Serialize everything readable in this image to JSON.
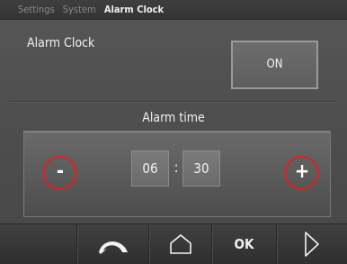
{
  "breadcrumb": {
    "items": [
      "Settings",
      "System",
      "Alarm Clock"
    ]
  },
  "alarm_clock": {
    "label": "Alarm Clock",
    "toggle_label": "ON"
  },
  "alarm_time": {
    "title": "Alarm time",
    "decrement_label": "-",
    "increment_label": "+",
    "hour": "06",
    "separator": ":",
    "minute": "30"
  },
  "nav": {
    "back_icon": "back-arrow-icon",
    "home_icon": "home-icon",
    "ok_label": "OK",
    "next_icon": "next-arrow-icon"
  },
  "colors": {
    "accent_ring": "#e02020",
    "background": "#4e4e4e"
  }
}
